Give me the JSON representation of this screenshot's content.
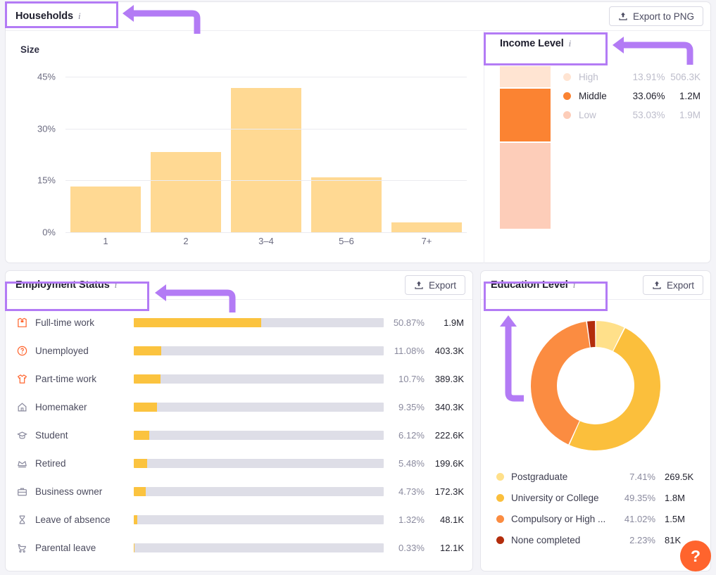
{
  "households": {
    "title": "Households",
    "info_icon": "info-icon",
    "export_label": "Export to PNG",
    "section_label": "Size",
    "income": {
      "title": "Income Level",
      "info_icon": "info-icon",
      "rows": [
        {
          "label": "High",
          "pct": "13.91%",
          "value": "506.3K",
          "color": "#FFE4D2",
          "state": "dim"
        },
        {
          "label": "Middle",
          "pct": "33.06%",
          "value": "1.2M",
          "color": "#FB8332",
          "state": "hot"
        },
        {
          "label": "Low",
          "pct": "53.03%",
          "value": "1.9M",
          "color": "#FDCDB9",
          "state": "dim"
        }
      ]
    }
  },
  "employment": {
    "title": "Employment Status",
    "info_icon": "info-icon",
    "export_label": "Export",
    "rows": [
      {
        "icon": "shirt-icon",
        "label": "Full-time work",
        "pct": "50.87%",
        "value": "1.9M",
        "fill": 50.87
      },
      {
        "icon": "question-icon",
        "label": "Unemployed",
        "pct": "11.08%",
        "value": "403.3K",
        "fill": 11.08
      },
      {
        "icon": "tshirt-icon",
        "label": "Part-time work",
        "pct": "10.7%",
        "value": "389.3K",
        "fill": 10.7
      },
      {
        "icon": "home-icon",
        "label": "Homemaker",
        "pct": "9.35%",
        "value": "340.3K",
        "fill": 9.35
      },
      {
        "icon": "graduation-icon",
        "label": "Student",
        "pct": "6.12%",
        "value": "222.6K",
        "fill": 6.12
      },
      {
        "icon": "crown-icon",
        "label": "Retired",
        "pct": "5.48%",
        "value": "199.6K",
        "fill": 5.48
      },
      {
        "icon": "briefcase-icon",
        "label": "Business owner",
        "pct": "4.73%",
        "value": "172.3K",
        "fill": 4.73
      },
      {
        "icon": "hourglass-icon",
        "label": "Leave of absence",
        "pct": "1.32%",
        "value": "48.1K",
        "fill": 1.32
      },
      {
        "icon": "stroller-icon",
        "label": "Parental leave",
        "pct": "0.33%",
        "value": "12.1K",
        "fill": 0.33
      }
    ]
  },
  "education": {
    "title": "Education Level",
    "info_icon": "info-icon",
    "export_label": "Export",
    "rows": [
      {
        "label": "Postgraduate",
        "pct": "7.41%",
        "value": "269.5K",
        "color": "#FFE08A"
      },
      {
        "label": "University or College",
        "pct": "49.35%",
        "value": "1.8M",
        "color": "#FBBF3C"
      },
      {
        "label": "Compulsory or High ...",
        "pct": "41.02%",
        "value": "1.5M",
        "color": "#FB8C41"
      },
      {
        "label": "None completed",
        "pct": "2.23%",
        "value": "81K",
        "color": "#B32D0C"
      }
    ]
  },
  "help": {
    "label": "?"
  },
  "annotations": {
    "accent": "#B37BF5",
    "arrows": [
      "arrow-to-households-title",
      "arrow-to-income-level-title",
      "arrow-to-employment-status-title",
      "arrow-to-education-level-title"
    ]
  },
  "chart_data": [
    {
      "type": "bar",
      "title": "Households",
      "subtitle": "Size",
      "xlabel": "",
      "ylabel": "",
      "categories": [
        "1",
        "2",
        "3–4",
        "5–6",
        "7+"
      ],
      "values": [
        13.5,
        23.5,
        42.0,
        16.0,
        3.0
      ],
      "yticks": [
        "0%",
        "15%",
        "30%",
        "45%"
      ],
      "ytick_values": [
        0,
        15,
        30,
        45
      ],
      "ylim": [
        0,
        45
      ],
      "grid": true,
      "legend": "none",
      "series_color": "#FFD993"
    },
    {
      "type": "bar",
      "title": "Income Level",
      "stacked": true,
      "orientation": "vertical",
      "categories": [
        "High",
        "Middle",
        "Low"
      ],
      "values": [
        13.91,
        33.06,
        53.03
      ],
      "absolute": [
        "506.3K",
        "1.2M",
        "1.9M"
      ],
      "colors": [
        "#FFE4D2",
        "#FB8332",
        "#FDCDB9"
      ],
      "legend": "right",
      "highlighted": "Middle"
    },
    {
      "type": "bar",
      "title": "Employment Status",
      "orientation": "horizontal",
      "categories": [
        "Full-time work",
        "Unemployed",
        "Part-time work",
        "Homemaker",
        "Student",
        "Retired",
        "Business owner",
        "Leave of absence",
        "Parental leave"
      ],
      "values": [
        50.87,
        11.08,
        10.7,
        9.35,
        6.12,
        5.48,
        4.73,
        1.32,
        0.33
      ],
      "absolute": [
        "1.9M",
        "403.3K",
        "389.3K",
        "340.3K",
        "222.6K",
        "199.6K",
        "172.3K",
        "48.1K",
        "12.1K"
      ],
      "xlim": [
        0,
        100
      ],
      "grid": false,
      "legend": "none",
      "series_color": "#FBC33F",
      "track_color": "#DEDEE7"
    },
    {
      "type": "pie",
      "variant": "donut",
      "title": "Education Level",
      "categories": [
        "Postgraduate",
        "University or College",
        "Compulsory or High ...",
        "None completed"
      ],
      "values": [
        7.41,
        49.35,
        41.02,
        2.23
      ],
      "absolute": [
        "269.5K",
        "1.8M",
        "1.5M",
        "81K"
      ],
      "colors": [
        "#FFE08A",
        "#FBBF3C",
        "#FB8C41",
        "#B32D0C"
      ],
      "legend": "bottom"
    }
  ]
}
